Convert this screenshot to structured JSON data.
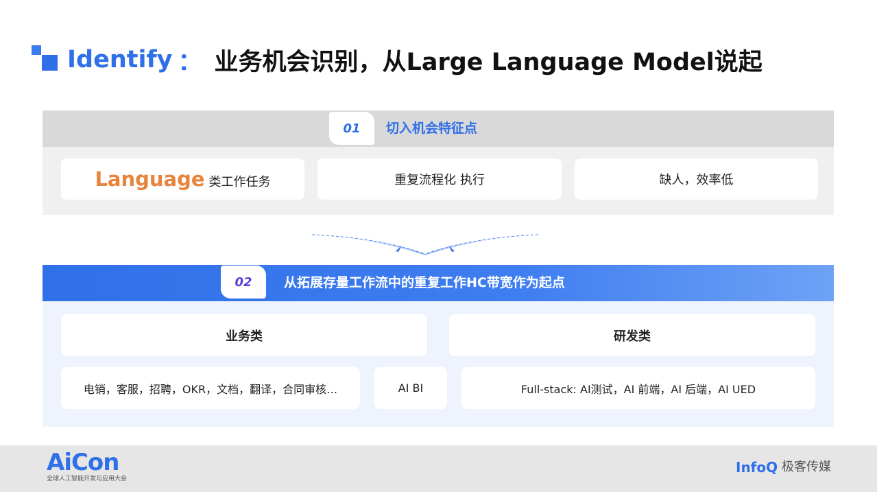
{
  "title": {
    "english": "Identify",
    "colon": "：",
    "rest": "业务机会识别，从Large Language Model说起"
  },
  "section1": {
    "number": "01",
    "heading": "切入机会特征点",
    "cards": {
      "language_word": "Language",
      "language_rest": "类工作任务",
      "repeat": "重复流程化 执行",
      "shortage": "缺人，效率低"
    }
  },
  "section2": {
    "number": "02",
    "heading": "从拓展存量工作流中的重复工作HC带宽作为起点",
    "business_title": "业务类",
    "rd_title": "研发类",
    "business_items": "电销，客服，招聘，OKR，文档，翻译，合同审核…",
    "ai_bi": "AI BI",
    "fullstack": "Full-stack: AI测试，AI 前端，AI 后端，AI UED"
  },
  "footer": {
    "aicon": "AiCon",
    "aicon_sub": "全球人工智能开发与应用大会",
    "infoq": "InfoQ",
    "infoq_cn": "极客传媒"
  },
  "colors": {
    "accent_blue": "#2f6fe8",
    "language_orange": "#e8843c",
    "number_purple": "#5a3ed8"
  }
}
